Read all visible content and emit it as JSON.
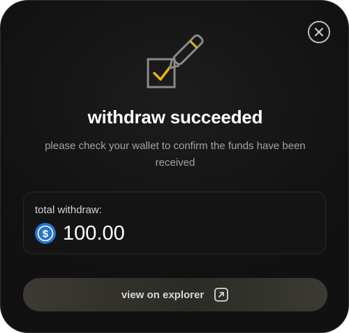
{
  "modal": {
    "title": "withdraw succeeded",
    "subtitle": "please check your wallet to confirm the funds have been received",
    "close_icon": "close-icon",
    "hero_icon": "checkbox-pen-icon",
    "accent_color": "#e7b416"
  },
  "summary": {
    "label": "total withdraw:",
    "amount": "100.00",
    "token_icon": "usdc-coin-icon",
    "token_color": "#2775ca"
  },
  "actions": {
    "explorer_label": "view on explorer",
    "explorer_icon": "external-link-icon"
  }
}
